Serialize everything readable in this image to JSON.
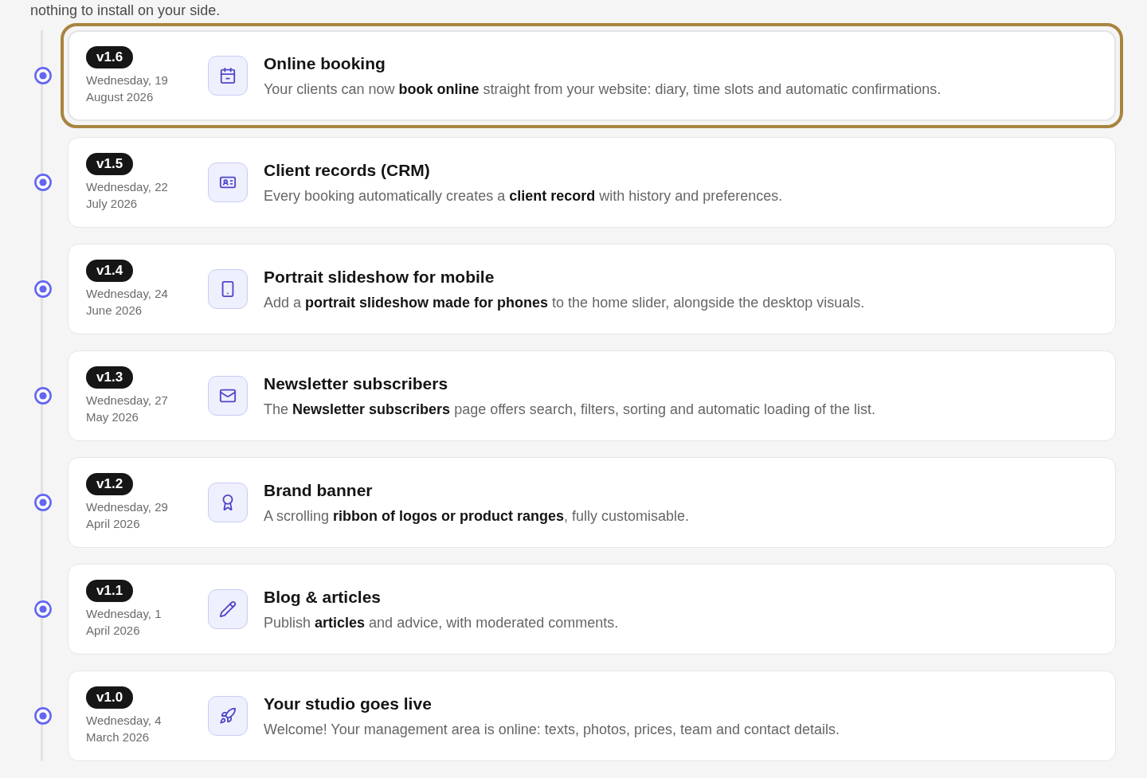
{
  "intro": "nothing to install on your side.",
  "releases": [
    {
      "version": "v1.6",
      "date": "Wednesday, 19 August 2026",
      "title": "Online booking",
      "description": "Your clients can now **book online** straight from your website: diary, time slots and automatic confirmations.",
      "selected": true
    },
    {
      "version": "v1.5",
      "date": "Wednesday, 22 July 2026",
      "title": "Client records (CRM)",
      "description": "Every booking automatically creates a **client record** with history and preferences.",
      "selected": false
    },
    {
      "version": "v1.4",
      "date": "Wednesday, 24 June 2026",
      "title": "Portrait slideshow for mobile",
      "description": "Add a **portrait slideshow made for phones** to the home slider, alongside the desktop visuals.",
      "selected": false
    },
    {
      "version": "v1.3",
      "date": "Wednesday, 27 May 2026",
      "title": "Newsletter subscribers",
      "description": "The **Newsletter subscribers** page offers search, filters, sorting and automatic loading of the list.",
      "selected": false
    },
    {
      "version": "v1.2",
      "date": "Wednesday, 29 April 2026",
      "title": "Brand banner",
      "description": "A scrolling **ribbon of logos or product ranges**, fully customisable.",
      "selected": false
    },
    {
      "version": "v1.1",
      "date": "Wednesday, 1 April 2026",
      "title": "Blog & articles",
      "description": "Publish **articles** and advice, with moderated comments.",
      "selected": false
    },
    {
      "version": "v1.0",
      "date": "Wednesday, 4 March 2026",
      "title": "Your studio goes live",
      "description": "Welcome! Your management area is online: texts, photos, prices, team and contact details.",
      "selected": false
    }
  ]
}
